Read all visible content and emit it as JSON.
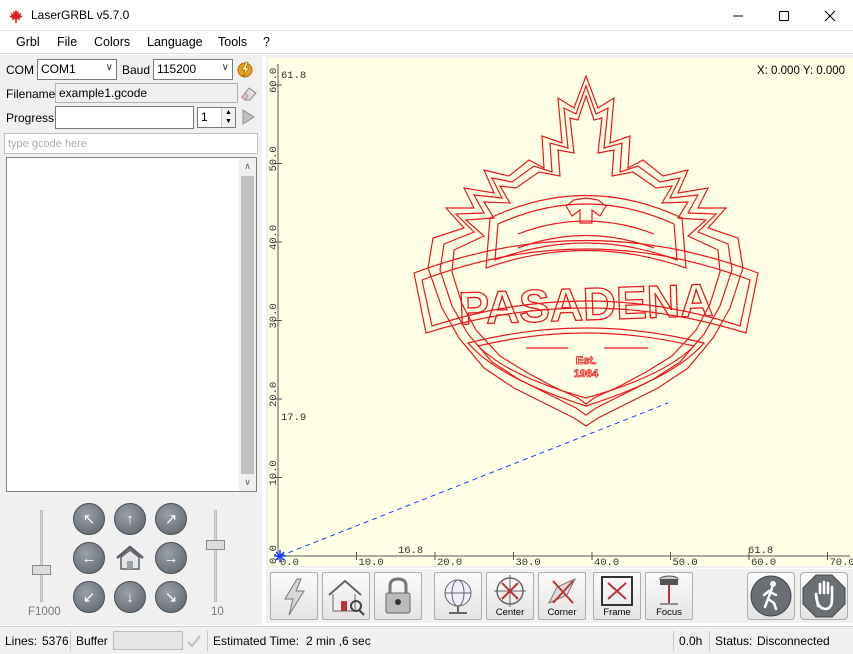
{
  "window": {
    "title": "LaserGRBL v5.7.0"
  },
  "menu": {
    "items": [
      "Grbl",
      "File",
      "Colors",
      "Language",
      "Tools",
      "?"
    ]
  },
  "connection": {
    "com_label": "COM",
    "com_value": "COM1",
    "baud_label": "Baud",
    "baud_value": "115200",
    "filename_label": "Filename",
    "filename_value": "example1.gcode",
    "progress_label": "Progress",
    "progress_fraction": 0.0,
    "passes_value": "1"
  },
  "gcode_input": {
    "placeholder": "type gcode here"
  },
  "jog": {
    "speed_label": "F1000",
    "step_label": "10"
  },
  "canvas": {
    "coords_text": "X: 0.000 Y: 0.000",
    "y_ticks": [
      "0.0",
      "10.0",
      "20.0",
      "30.0",
      "40.0",
      "50.0",
      "60.0"
    ],
    "x_ticks": [
      "0.0",
      "10.0",
      "20.0",
      "30.0",
      "40.0",
      "50.0",
      "60.0",
      "70.0"
    ],
    "y_bounds": [
      "61.8",
      "17.9"
    ],
    "x_bounds": [
      "16.8",
      "61.8"
    ],
    "logo_text": {
      "main": "PASADENA",
      "est": "Est.",
      "year": "1964"
    }
  },
  "toolbar": {
    "center_label": "Center",
    "corner_label": "Corner",
    "frame_label": "Frame",
    "focus_label": "Focus"
  },
  "status": {
    "lines_label": "Lines:",
    "lines_value": "5376",
    "buffer_label": "Buffer",
    "buffer_fraction": 0.0,
    "est_label": "Estimated Time:",
    "est_value": "2 min ,6 sec",
    "elapsed": "0.0h",
    "status_label": "Status:",
    "status_value": "Disconnected"
  },
  "colors": {
    "canvas_bg": "#ffffe6",
    "path_red": "#e8181c",
    "rapid_blue": "#1a3cff"
  }
}
